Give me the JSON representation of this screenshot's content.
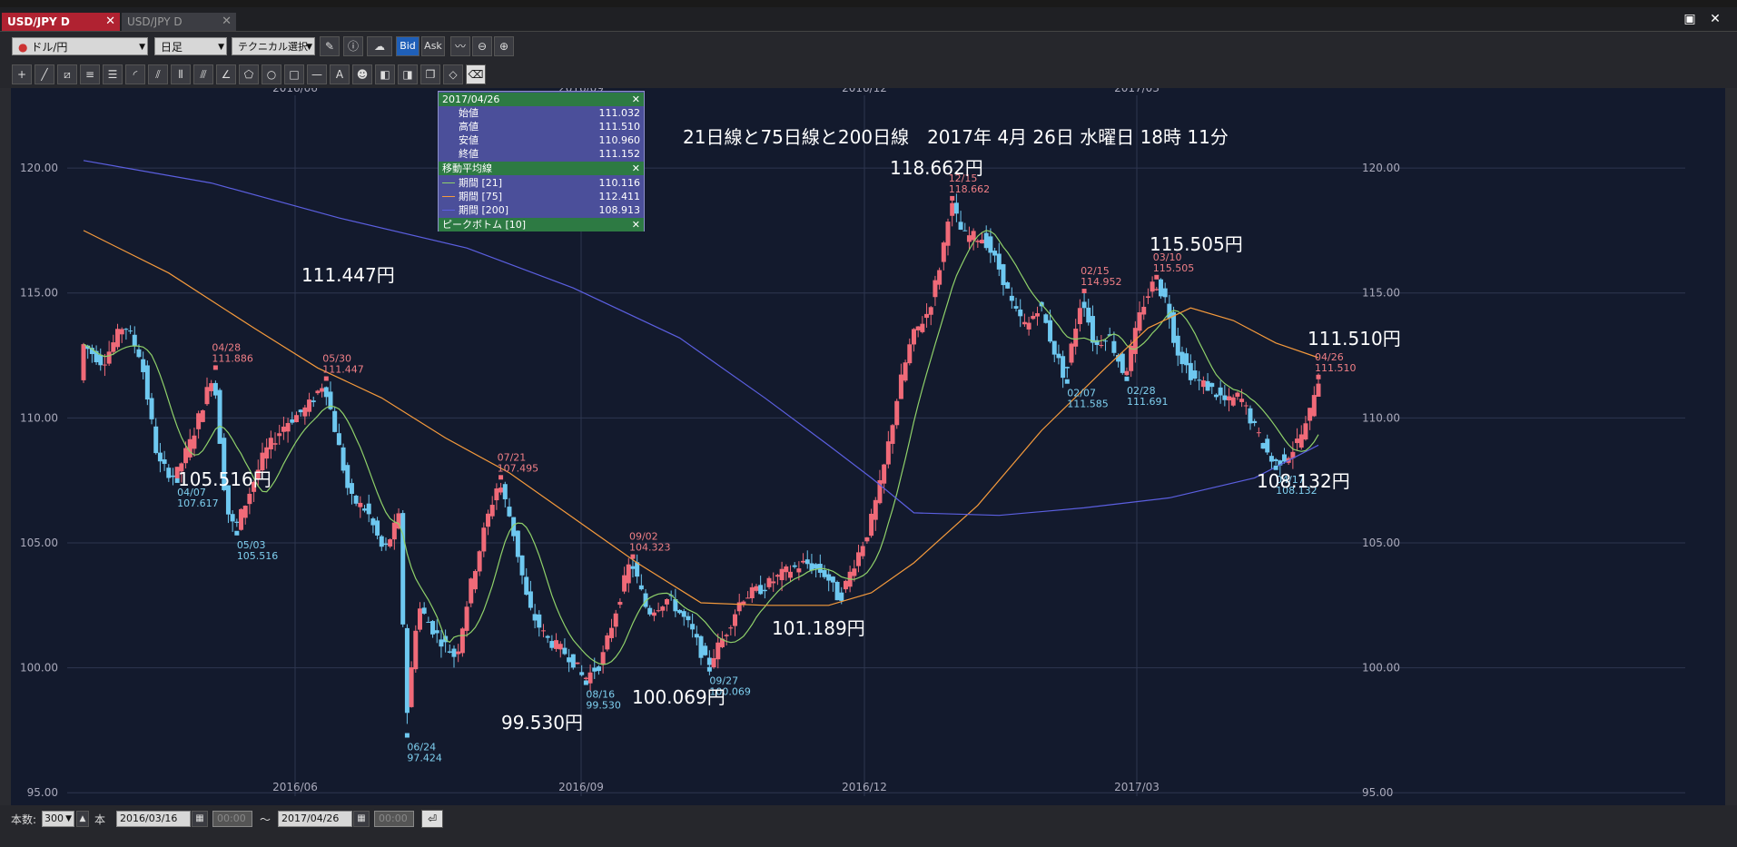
{
  "tabs": [
    {
      "label": "USD/JPY D",
      "active": true
    },
    {
      "label": "USD/JPY D",
      "active": false
    }
  ],
  "toolbar": {
    "currency_pair": "ドル/円",
    "timeframe": "日足",
    "technical_select": "テクニカル選択",
    "bid_label": "Bid",
    "ask_label": "Ask"
  },
  "chart_title": "21日線と75日線と200日線　2017年 4月 26日 水曜日 18時 11分",
  "info_panel": {
    "date": "2017/04/26",
    "ohlc": [
      {
        "label": "始値",
        "value": "111.032"
      },
      {
        "label": "高値",
        "value": "111.510"
      },
      {
        "label": "安値",
        "value": "110.960"
      },
      {
        "label": "終値",
        "value": "111.152"
      }
    ],
    "ma_header": "移動平均線",
    "ma": [
      {
        "label": "期間 [21]",
        "value": "110.116",
        "color": "#8fd16a"
      },
      {
        "label": "期間 [75]",
        "value": "112.411",
        "color": "#f59a3c"
      },
      {
        "label": "期間 [200]",
        "value": "108.913",
        "color": "#5b5fe0"
      }
    ],
    "peak_header": "ピークボトム [10]"
  },
  "chart_data": {
    "type": "candlestick",
    "x_ticks": [
      "2016/06",
      "2016/09",
      "2016/12",
      "2017/03"
    ],
    "y_ticks": [
      "120.00",
      "115.00",
      "110.00",
      "105.00",
      "100.00",
      "95.00"
    ],
    "ylim": [
      94.5,
      123.2
    ],
    "grid": true,
    "peaks": [
      {
        "date": "04/28",
        "value": "111.886"
      },
      {
        "date": "05/30",
        "value": "111.447"
      },
      {
        "date": "07/21",
        "value": "107.495"
      },
      {
        "date": "09/02",
        "value": "104.323"
      },
      {
        "date": "12/15",
        "value": "118.662"
      },
      {
        "date": "02/15",
        "value": "114.952"
      },
      {
        "date": "03/10",
        "value": "115.505"
      },
      {
        "date": "04/26",
        "value": "111.510"
      }
    ],
    "bottoms": [
      {
        "date": "04/07",
        "value": "107.617"
      },
      {
        "date": "05/03",
        "value": "105.516"
      },
      {
        "date": "06/24",
        "value": "97.424"
      },
      {
        "date": "08/16",
        "value": "99.530"
      },
      {
        "date": "09/27",
        "value": "100.069"
      },
      {
        "date": "02/07",
        "value": "111.585"
      },
      {
        "date": "02/28",
        "value": "111.691"
      },
      {
        "date": "04/17",
        "value": "108.132"
      }
    ],
    "annotations": [
      "111.447円",
      "105.516円",
      "99.530円",
      "100.069円",
      "101.189円",
      "118.662円",
      "115.505円",
      "111.510円",
      "108.132円"
    ],
    "ma21_color": "#8fd16a",
    "ma75_color": "#f59a3c",
    "ma200_color": "#5b5fe0",
    "up_color": "#f06a78",
    "down_color": "#6ec8f0"
  },
  "footer": {
    "count_label": "本数:",
    "count_value": "300",
    "count_unit": "本",
    "start_date": "2016/03/16",
    "start_time": "00:00",
    "tilde": "〜",
    "end_date": "2017/04/26",
    "end_time": "00:00"
  }
}
